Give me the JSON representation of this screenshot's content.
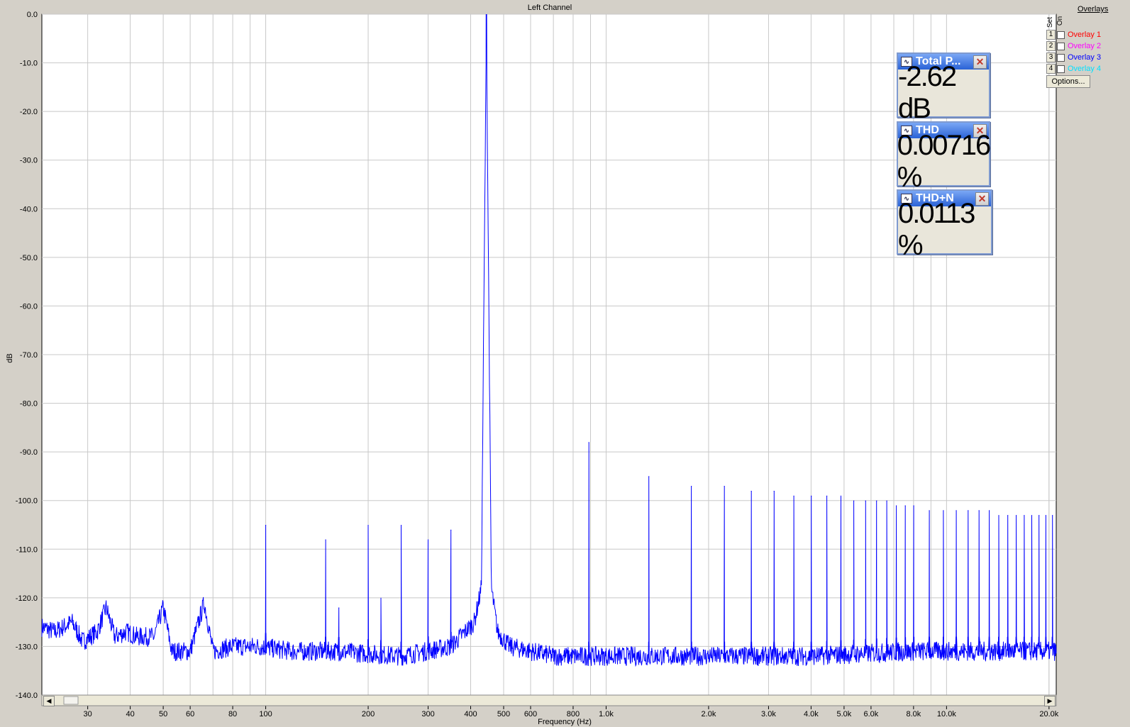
{
  "window": {
    "title": "Left Channel"
  },
  "overlays": {
    "header": "Overlays",
    "set_label": "Set",
    "on_label": "On",
    "items": [
      {
        "num": "1",
        "label": "Overlay 1",
        "color": "#ff0000"
      },
      {
        "num": "2",
        "label": "Overlay 2",
        "color": "#ff00ff"
      },
      {
        "num": "3",
        "label": "Overlay 3",
        "color": "#0000ff"
      },
      {
        "num": "4",
        "label": "Overlay 4",
        "color": "#00e0ff"
      }
    ],
    "options_label": "Options..."
  },
  "meters": [
    {
      "title": "Total P...",
      "value": "-2.62 dB"
    },
    {
      "title": "THD",
      "value": "0.00716 %"
    },
    {
      "title": "THD+N",
      "value": "0.0113 %"
    }
  ],
  "chart_data": {
    "type": "line",
    "title": "Left Channel",
    "xlabel": "Frequency (Hz)",
    "ylabel": "dB",
    "x_scale": "log",
    "xlim": [
      22,
      21000
    ],
    "ylim": [
      -140,
      0
    ],
    "grid": true,
    "line_color": "#0000ff",
    "x_tick_labels": [
      {
        "value": 30,
        "label": "30"
      },
      {
        "value": 40,
        "label": "40"
      },
      {
        "value": 50,
        "label": "50"
      },
      {
        "value": 60,
        "label": "60"
      },
      {
        "value": 80,
        "label": "80"
      },
      {
        "value": 100,
        "label": "100"
      },
      {
        "value": 200,
        "label": "200"
      },
      {
        "value": 300,
        "label": "300"
      },
      {
        "value": 400,
        "label": "400"
      },
      {
        "value": 500,
        "label": "500"
      },
      {
        "value": 600,
        "label": "600"
      },
      {
        "value": 800,
        "label": "800"
      },
      {
        "value": 1000,
        "label": "1.0k"
      },
      {
        "value": 2000,
        "label": "2.0k"
      },
      {
        "value": 3000,
        "label": "3.0k"
      },
      {
        "value": 4000,
        "label": "4.0k"
      },
      {
        "value": 5000,
        "label": "5.0k"
      },
      {
        "value": 6000,
        "label": "6.0k"
      },
      {
        "value": 8000,
        "label": "8.0k"
      },
      {
        "value": 10000,
        "label": "10.0k"
      },
      {
        "value": 20000,
        "label": "20.0k"
      }
    ],
    "y_tick_labels": [
      "0.0",
      "-10.0",
      "-20.0",
      "-30.0",
      "-40.0",
      "-50.0",
      "-60.0",
      "-70.0",
      "-80.0",
      "-90.0",
      "-100.0",
      "-110.0",
      "-120.0",
      "-130.0",
      "-140.0"
    ],
    "noise_floor": [
      [
        22,
        -126
      ],
      [
        24,
        -127
      ],
      [
        27,
        -125
      ],
      [
        29,
        -129
      ],
      [
        32,
        -127
      ],
      [
        34,
        -122
      ],
      [
        36,
        -128
      ],
      [
        39,
        -127
      ],
      [
        42,
        -128
      ],
      [
        47,
        -128
      ],
      [
        50,
        -122
      ],
      [
        53,
        -131
      ],
      [
        60,
        -131
      ],
      [
        66,
        -121
      ],
      [
        70,
        -131
      ],
      [
        80,
        -130
      ],
      [
        95,
        -130
      ],
      [
        120,
        -131
      ],
      [
        160,
        -131
      ],
      [
        250,
        -132
      ],
      [
        350,
        -130
      ],
      [
        410,
        -125
      ],
      [
        430,
        -118
      ],
      [
        445,
        -3
      ],
      [
        460,
        -118
      ],
      [
        480,
        -127
      ],
      [
        520,
        -130
      ],
      [
        700,
        -132
      ],
      [
        1000,
        -132
      ],
      [
        2000,
        -132
      ],
      [
        4000,
        -132
      ],
      [
        8000,
        -131
      ],
      [
        21000,
        -131
      ]
    ],
    "peaks": [
      [
        100,
        -105
      ],
      [
        150,
        -108
      ],
      [
        164,
        -122
      ],
      [
        200,
        -105
      ],
      [
        218,
        -120
      ],
      [
        250,
        -105
      ],
      [
        300,
        -108
      ],
      [
        350,
        -106
      ],
      [
        445,
        -3
      ],
      [
        890,
        -88
      ],
      [
        1335,
        -95
      ],
      [
        1780,
        -97
      ],
      [
        2225,
        -97
      ],
      [
        2670,
        -98
      ],
      [
        3115,
        -98
      ],
      [
        3560,
        -99
      ],
      [
        4005,
        -99
      ],
      [
        4450,
        -99
      ],
      [
        4895,
        -99
      ],
      [
        5340,
        -100
      ],
      [
        5785,
        -100
      ],
      [
        6230,
        -100
      ],
      [
        6675,
        -100
      ],
      [
        7120,
        -101
      ],
      [
        7565,
        -101
      ],
      [
        8010,
        -101
      ],
      [
        8900,
        -102
      ],
      [
        9790,
        -102
      ],
      [
        10680,
        -102
      ],
      [
        11570,
        -102
      ],
      [
        12460,
        -102
      ],
      [
        13350,
        -102
      ],
      [
        14240,
        -103
      ],
      [
        15130,
        -103
      ],
      [
        16020,
        -103
      ],
      [
        16910,
        -103
      ],
      [
        17800,
        -103
      ],
      [
        18690,
        -103
      ],
      [
        19580,
        -103
      ],
      [
        20470,
        -103
      ]
    ]
  }
}
